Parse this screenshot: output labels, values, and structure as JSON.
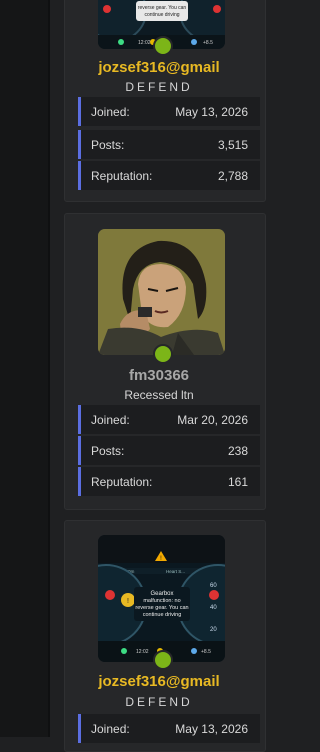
{
  "posts": [
    {
      "avatar": "car-dashboard-avatar",
      "username": "jozsef316@gmail",
      "username_color": "#e8b923",
      "user_title": "DEFEND",
      "stats": [
        {
          "label": "Joined:",
          "value": "May 13, 2026"
        },
        {
          "label": "Posts:",
          "value": "3,515"
        },
        {
          "label": "Reputation:",
          "value": "2,788"
        }
      ]
    },
    {
      "avatar": "anime-character-avatar",
      "username": "fm30366",
      "username_color": "#a7a7a7",
      "user_title": "Recessed ltn",
      "stats": [
        {
          "label": "Joined:",
          "value": "Mar 20, 2026"
        },
        {
          "label": "Posts:",
          "value": "238"
        },
        {
          "label": "Reputation:",
          "value": "161"
        }
      ]
    },
    {
      "avatar": "car-dashboard-avatar",
      "avatar_text": {
        "line1": "Gearbox",
        "line2": "malfunction: no",
        "line3": "reverse gear. You can",
        "line4": "continue driving",
        "mileage": "12:02",
        "temp": "+8.5"
      },
      "username": "jozsef316@gmail",
      "username_color": "#e8b923",
      "user_title": "DEFEND",
      "stats": [
        {
          "label": "Joined:",
          "value": "May 13, 2026"
        }
      ]
    }
  ]
}
